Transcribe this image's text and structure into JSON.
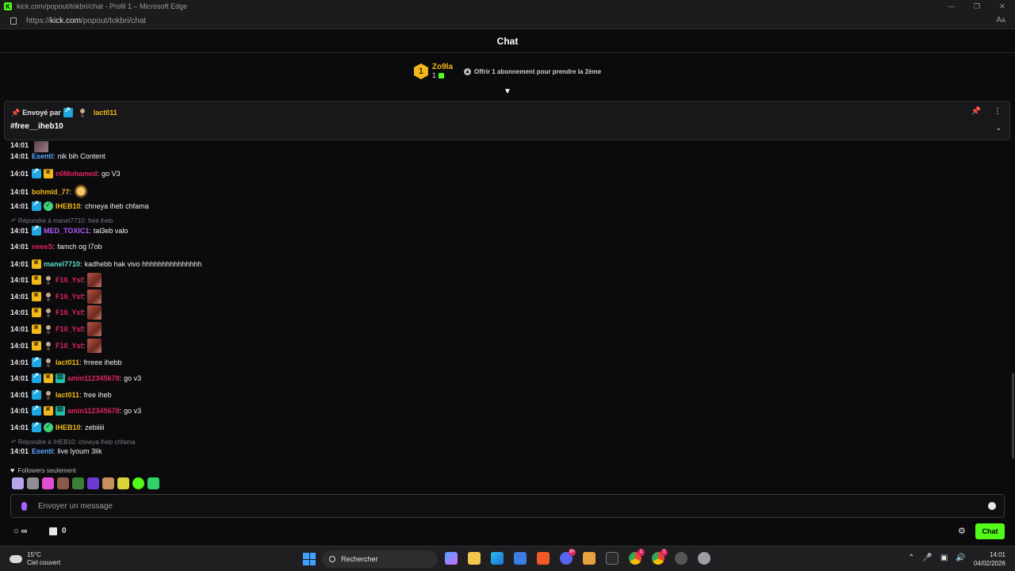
{
  "window": {
    "title": "kick.com/popout/tokbri/chat - Profil 1 – Microsoft Edge",
    "url_prefix": "https://",
    "url_domain": "kick.com",
    "url_path": "/popout/tokbri/chat",
    "reader_icon": "Aᴀ"
  },
  "header": {
    "title": "Chat"
  },
  "gifter": {
    "rank": "1",
    "name": "Zo9la",
    "count": "1",
    "offer": "Offrir 1 abonnement pour prendre la 2ème"
  },
  "pinned": {
    "sent_by": "Envoyé par",
    "username": "lact011",
    "message": "#free__iheb10"
  },
  "messages": [
    {
      "time": "14:01",
      "user": "Esenti",
      "color": "#5ca8ff",
      "badges": [],
      "text": "nik bih Content"
    },
    {
      "time": "14:01",
      "user": "n0Mohamed",
      "color": "#e0245e",
      "badges": [
        "mod",
        "crown"
      ],
      "text": "go V3"
    },
    {
      "time": "14:01",
      "user": "bohmid_77",
      "color": "#f2b91a",
      "badges": [],
      "text": ""
    },
    {
      "time": "14:01",
      "user": "IHEB10",
      "color": "#f2b91a",
      "badges": [
        "mod",
        "verified"
      ],
      "text": "chneya iheb chfama"
    },
    {
      "time": "14:01",
      "user": "MED_TOXIC1",
      "color": "#b05cff",
      "badges": [
        "mod"
      ],
      "text": "tal3eb valo"
    },
    {
      "time": "14:01",
      "user": "neeeS",
      "color": "#e0245e",
      "badges": [],
      "text": "famch og l7ob"
    },
    {
      "time": "14:01",
      "user": "manel7710",
      "color": "#5ce0c8",
      "badges": [
        "crown"
      ],
      "text": "kadhebb hak vivo hhhhhhhhhhhhhhh"
    },
    {
      "time": "14:01",
      "user": "F10_Ysf",
      "color": "#e0245e",
      "badges": [
        "crown",
        "person"
      ],
      "text": ""
    },
    {
      "time": "14:01",
      "user": "F10_Ysf",
      "color": "#e0245e",
      "badges": [
        "crown",
        "person"
      ],
      "text": ""
    },
    {
      "time": "14:01",
      "user": "F10_Ysf",
      "color": "#e0245e",
      "badges": [
        "crown",
        "person"
      ],
      "text": ""
    },
    {
      "time": "14:01",
      "user": "F10_Ysf",
      "color": "#e0245e",
      "badges": [
        "crown",
        "person"
      ],
      "text": ""
    },
    {
      "time": "14:01",
      "user": "F10_Ysf",
      "color": "#e0245e",
      "badges": [
        "crown",
        "person"
      ],
      "text": ""
    },
    {
      "time": "14:01",
      "user": "lact011",
      "color": "#f2b91a",
      "badges": [
        "mod",
        "person"
      ],
      "text": "frreee ihebb"
    },
    {
      "time": "14:01",
      "user": "amin112345678",
      "color": "#e0245e",
      "badges": [
        "mod",
        "crown",
        "gift"
      ],
      "text": "go v3"
    },
    {
      "time": "14:01",
      "user": "lact011",
      "color": "#f2b91a",
      "badges": [
        "mod",
        "person"
      ],
      "text": "free iheb"
    },
    {
      "time": "14:01",
      "user": "amin112345678",
      "color": "#e0245e",
      "badges": [
        "mod",
        "crown",
        "gift"
      ],
      "text": "go v3"
    },
    {
      "time": "14:01",
      "user": "IHEB10",
      "color": "#f2b91a",
      "badges": [
        "mod",
        "verified"
      ],
      "text": "zebiiiii"
    },
    {
      "time": "14:01",
      "user": "Esenti",
      "color": "#5ca8ff",
      "badges": [],
      "text": "live lyoum 3lik"
    }
  ],
  "replies": [
    {
      "text": "Répondre à manel7710: free iheb"
    },
    {
      "text": "Répondre à IHEB10: chneya iheb chfama"
    }
  ],
  "followers_only": "Followers seulement",
  "input": {
    "placeholder": "Envoyer un message"
  },
  "bottom": {
    "points_symbol": "∞",
    "gift_count": "0",
    "send_label": "Chat"
  },
  "taskbar": {
    "temp": "15°C",
    "weather": "Ciel couvert",
    "search": "Rechercher",
    "time": "14:01",
    "date": "04/02/2026",
    "badge_discord": "9+",
    "badge_chrome1": "1",
    "badge_chrome2": "1"
  },
  "colors": {
    "accent": "#53fc18",
    "background": "#0b0b0d"
  }
}
